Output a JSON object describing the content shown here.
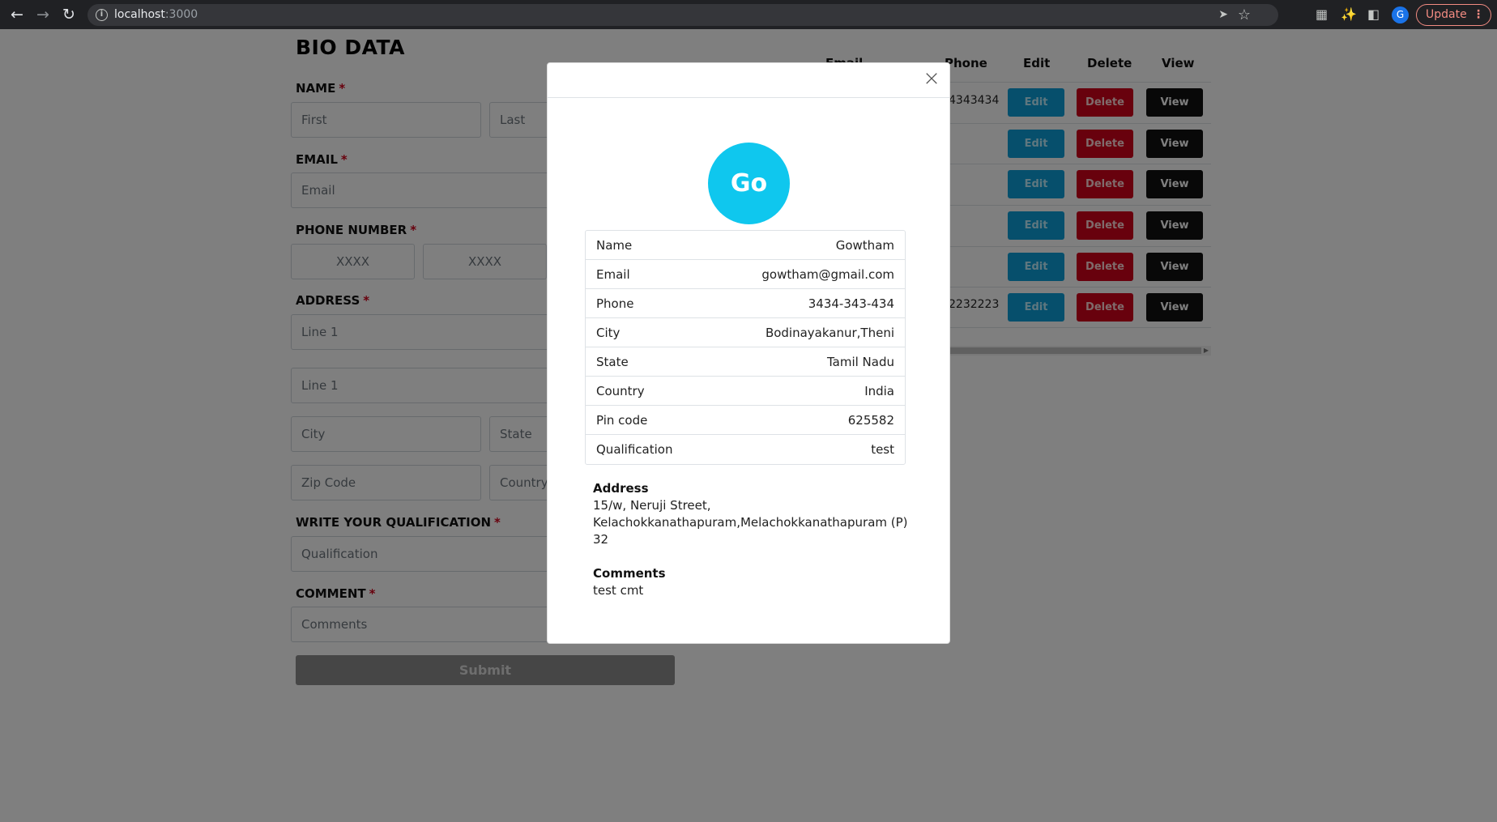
{
  "browser": {
    "url_host": "localhost",
    "url_port": ":3000",
    "profile_initial": "G",
    "update_label": "Update"
  },
  "form": {
    "title": "BIO DATA",
    "name_label": "NAME",
    "first_placeholder": "First",
    "last_placeholder": "Last",
    "email_label": "EMAIL",
    "email_placeholder": "Email",
    "phone_label": "PHONE NUMBER",
    "phone_placeholder_1": "XXXX",
    "phone_placeholder_2": "XXXX",
    "address_label": "ADDRESS",
    "line1_placeholder": "Line 1",
    "line2_placeholder": "Line 1",
    "city_placeholder": "City",
    "state_placeholder": "State",
    "zip_placeholder": "Zip Code",
    "country_placeholder": "Country",
    "qualification_label": "WRITE YOUR QUALIFICATION",
    "qualification_placeholder": "Qualification",
    "comment_label": "COMMENT",
    "comment_placeholder": "Comments",
    "required_mark": "*",
    "submit_label": "Submit"
  },
  "table": {
    "headers": {
      "email": "Email",
      "phone": "Phone",
      "edit": "Edit",
      "delete": "Delete",
      "view": "View"
    },
    "rows": [
      {
        "phone": "4343434",
        "edit": "Edit",
        "delete": "Delete",
        "view": "View"
      },
      {
        "phone": "",
        "edit": "Edit",
        "delete": "Delete",
        "view": "View"
      },
      {
        "phone": "",
        "edit": "Edit",
        "delete": "Delete",
        "view": "View"
      },
      {
        "phone": "",
        "edit": "Edit",
        "delete": "Delete",
        "view": "View"
      },
      {
        "phone": "",
        "edit": "Edit",
        "delete": "Delete",
        "view": "View"
      },
      {
        "phone": "2232223",
        "edit": "Edit",
        "delete": "Delete",
        "view": "View"
      }
    ]
  },
  "modal": {
    "avatar_text": "Go",
    "details": [
      {
        "key": "Name",
        "value": "Gowtham"
      },
      {
        "key": "Email",
        "value": "gowtham@gmail.com"
      },
      {
        "key": "Phone",
        "value": "3434-343-434"
      },
      {
        "key": "City",
        "value": "Bodinayakanur,Theni"
      },
      {
        "key": "State",
        "value": "Tamil Nadu"
      },
      {
        "key": "Country",
        "value": "India"
      },
      {
        "key": "Pin code",
        "value": "625582"
      },
      {
        "key": "Qualification",
        "value": "test"
      }
    ],
    "address_title": "Address",
    "address_lines": [
      "15/w, Neruji Street,",
      "Kelachokkanathapuram,Melachokkanathapuram (P)",
      "32"
    ],
    "comments_title": "Comments",
    "comments_text": "test cmt"
  }
}
